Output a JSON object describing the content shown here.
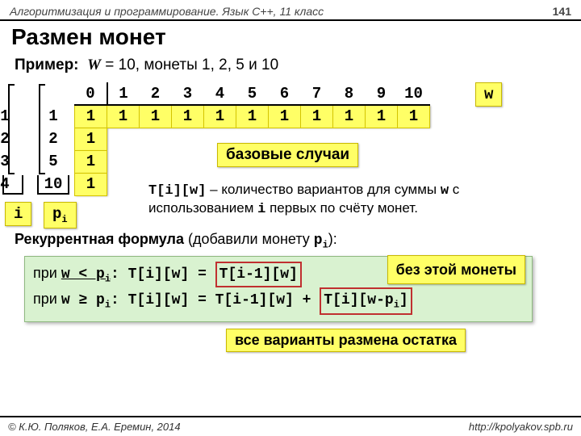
{
  "header": {
    "subject": "Алгоритмизация и программирование. Язык C++, 11 класс",
    "page": "141"
  },
  "title": "Размен монет",
  "example": {
    "label": "Пример:",
    "W": "W",
    "rest": " = 10, монеты 1, 2, 5 и 10"
  },
  "table": {
    "colhead": [
      "0",
      "1",
      "2",
      "3",
      "4",
      "5",
      "6",
      "7",
      "8",
      "9",
      "10"
    ],
    "rowidx": [
      "1",
      "2",
      "3",
      "4"
    ],
    "coins": [
      "1",
      "2",
      "5",
      "10"
    ],
    "row1": [
      "1",
      "1",
      "1",
      "1",
      "1",
      "1",
      "1",
      "1",
      "1",
      "1",
      "1"
    ],
    "colzero_rest": [
      "1",
      "1",
      "1"
    ]
  },
  "wlabel": "w",
  "base_cases": "базовые случаи",
  "labels": {
    "i": "i",
    "p": "p",
    "psub": "i"
  },
  "explain": {
    "t": "T[i][w]",
    "text1": " – количество вариантов для суммы ",
    "w": "w",
    "text2": " с использованием ",
    "i": "i",
    "text3": " первых по счёту монет."
  },
  "recurrent": {
    "bold": "Рекуррентная формула",
    "rest": " (добавили монету ",
    "p": "p",
    "sub": "i",
    "end": "):"
  },
  "formula": {
    "line1a": "при ",
    "cond1": "w < p",
    "cond1sub": "i",
    "mid": ": T[i][w] = ",
    "box1": "T[i-1][w]",
    "line2a": "при ",
    "cond2": "w ≥ p",
    "cond2sub": "i",
    "mid2": ": T[i][w] = T[i-1][w] + ",
    "box2a": "T[i][w-p",
    "box2sub": "i",
    "box2b": "]",
    "call1": "без этой монеты",
    "call2": "все варианты размена остатка"
  },
  "footer": {
    "left": "© К.Ю. Поляков, Е.А. Еремин, 2014",
    "right": "http://kpolyakov.spb.ru"
  }
}
